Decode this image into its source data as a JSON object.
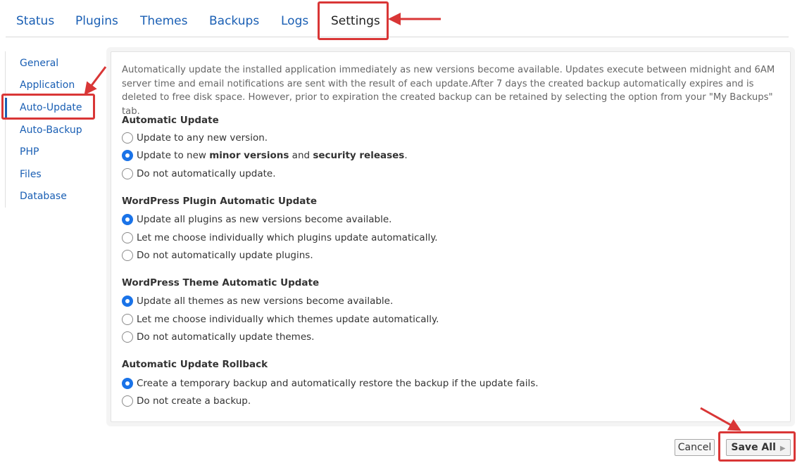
{
  "tabs": [
    {
      "label": "Status"
    },
    {
      "label": "Plugins"
    },
    {
      "label": "Themes"
    },
    {
      "label": "Backups"
    },
    {
      "label": "Logs"
    },
    {
      "label": "Settings",
      "active": true
    }
  ],
  "sidebar": {
    "items": [
      {
        "label": "General"
      },
      {
        "label": "Application"
      },
      {
        "label": "Auto-Update",
        "active": true
      },
      {
        "label": "Auto-Backup"
      },
      {
        "label": "PHP"
      },
      {
        "label": "Files"
      },
      {
        "label": "Database"
      }
    ]
  },
  "panel": {
    "description": "Automatically update the installed application immediately as new versions become available. Updates execute between midnight and 6AM server time and email notifications are sent with the result of each update.After 7 days the created backup automatically expires and is deleted to free disk space. However, prior to expiration the created backup can be retained by selecting the option from your \"My Backups\" tab.",
    "sections": [
      {
        "title": "Automatic Update",
        "options": [
          {
            "text": "Update to any new version.",
            "checked": false
          },
          {
            "parts": [
              "Update to new ",
              "minor versions",
              " and ",
              "security releases",
              "."
            ],
            "checked": true
          },
          {
            "text": "Do not automatically update.",
            "checked": false
          }
        ]
      },
      {
        "title": "WordPress Plugin Automatic Update",
        "options": [
          {
            "text": "Update all plugins as new versions become available.",
            "checked": true
          },
          {
            "text": "Let me choose individually which plugins update automatically.",
            "checked": false
          },
          {
            "text": "Do not automatically update plugins.",
            "checked": false
          }
        ]
      },
      {
        "title": "WordPress Theme Automatic Update",
        "options": [
          {
            "text": "Update all themes as new versions become available.",
            "checked": true
          },
          {
            "text": "Let me choose individually which themes update automatically.",
            "checked": false
          },
          {
            "text": "Do not automatically update themes.",
            "checked": false
          }
        ]
      },
      {
        "title": "Automatic Update Rollback",
        "options": [
          {
            "text": "Create a temporary backup and automatically restore the backup if the update fails.",
            "checked": true
          },
          {
            "text": "Do not create a backup.",
            "checked": false
          }
        ]
      }
    ]
  },
  "buttons": {
    "cancel": "Cancel",
    "save_all": "Save All"
  },
  "colors": {
    "link": "#1a5fb4",
    "radio_checked": "#1a73e8",
    "annotation_red": "#d93636"
  }
}
